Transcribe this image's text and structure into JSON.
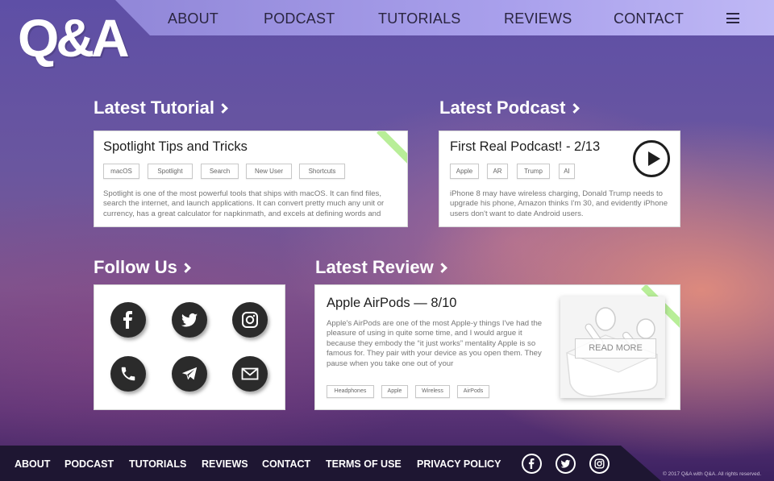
{
  "header": {
    "logo_text": "Q&A",
    "nav": [
      "ABOUT",
      "PODCAST",
      "TUTORIALS",
      "REVIEWS",
      "CONTACT"
    ],
    "menu_icon": "hamburger-menu-icon"
  },
  "tutorial": {
    "heading": "Latest Tutorial",
    "title": "Spotlight Tips and Tricks",
    "tags": [
      "macOS",
      "Spotlight",
      "Search",
      "New User",
      "Shortcuts"
    ],
    "description": "Spotlight is one of the most powerful tools that ships with macOS. It can find files, search the internet, and launch applications. It can convert pretty much any unit or currency, has a great calculator for napkinmath, and excels at defining words and"
  },
  "podcast": {
    "heading": "Latest Podcast",
    "title": "First Real Podcast! - 2/13",
    "tags": [
      "Apple",
      "AR",
      "Trump",
      "AI"
    ],
    "description": "iPhone 8 may have wireless charging, Donald Trump needs to upgrade his phone, Amazon thinks I'm 30, and evidently iPhone users don't want to date Android users.",
    "play_icon": "play-icon"
  },
  "follow": {
    "heading": "Follow Us",
    "icons": [
      "facebook-icon",
      "twitter-icon",
      "instagram-icon",
      "phone-icon",
      "telegram-icon",
      "email-icon"
    ]
  },
  "review": {
    "heading": "Latest Review",
    "title": "Apple AirPods — 8/10",
    "description": "Apple's AirPods are one of the most Apple-y things I've had the pleasure of using in quite some time, and I would argue it because they embody the “it just works” mentality Apple is so famous for. They pair with your device as you open them. They pause when you take one out of your",
    "tags": [
      "Headphones",
      "Apple",
      "Wireless",
      "AirPods"
    ],
    "read_more": "READ MORE"
  },
  "footer": {
    "links": [
      "ABOUT",
      "PODCAST",
      "TUTORIALS",
      "REVIEWS",
      "CONTACT",
      "TERMS OF USE",
      "PRIVACY POLICY"
    ],
    "social_icons": [
      "facebook-icon",
      "twitter-icon",
      "instagram-icon"
    ],
    "copyright": "© 2017 Q&A with Q&A. All rights reserved."
  },
  "colors": {
    "accent_ribbon": "#b8ee98",
    "header_bar": "#a9a0ec",
    "footer_bar": "#1e1632"
  }
}
